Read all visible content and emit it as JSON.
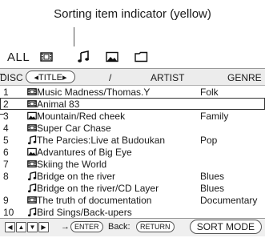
{
  "callout": {
    "text": "Sorting item indicator (yellow)"
  },
  "tabs": {
    "all": "ALL",
    "video_icon": "film-icon",
    "music_icon": "music-note-icon",
    "photo_icon": "photo-icon",
    "folder_icon": "folder-icon"
  },
  "header": {
    "disc": "DISC",
    "title": "◂TITLE▸",
    "slash": "/",
    "artist": "ARTIST",
    "genre": "GENRE"
  },
  "rows": [
    {
      "num": "1",
      "icon": "film",
      "title": "Music Madness/Thomas.Y",
      "genre": "Folk"
    },
    {
      "num": "2",
      "icon": "film",
      "title": "Animal 83",
      "genre": ""
    },
    {
      "num": "3",
      "icon": "photo",
      "title": "Mountain/Red cheek",
      "genre": "Family"
    },
    {
      "num": "4",
      "icon": "film",
      "title": "Super Car Chase",
      "genre": ""
    },
    {
      "num": "5",
      "icon": "music",
      "title": "The Parcies:Live at Budoukan",
      "genre": "Pop"
    },
    {
      "num": "6",
      "icon": "photo",
      "title": "Advantures of Big Eye",
      "genre": ""
    },
    {
      "num": "7",
      "icon": "film",
      "title": "Skiing the World",
      "genre": ""
    },
    {
      "num": "8",
      "icon": "music",
      "title": "Bridge on the river",
      "genre": "Blues"
    },
    {
      "num": "",
      "icon": "music",
      "title": "Bridge on the river/CD Layer",
      "genre": "Blues"
    },
    {
      "num": "9",
      "icon": "film",
      "title": "The truth of documentation",
      "genre": "Documentary"
    },
    {
      "num": "10",
      "icon": "music",
      "title": "Bird Sings/Back-upers",
      "genre": ""
    }
  ],
  "footer": {
    "arrow": "→",
    "enter": "ENTER",
    "back": "Back:",
    "return": "RETURN",
    "sort": "SORT MODE"
  }
}
